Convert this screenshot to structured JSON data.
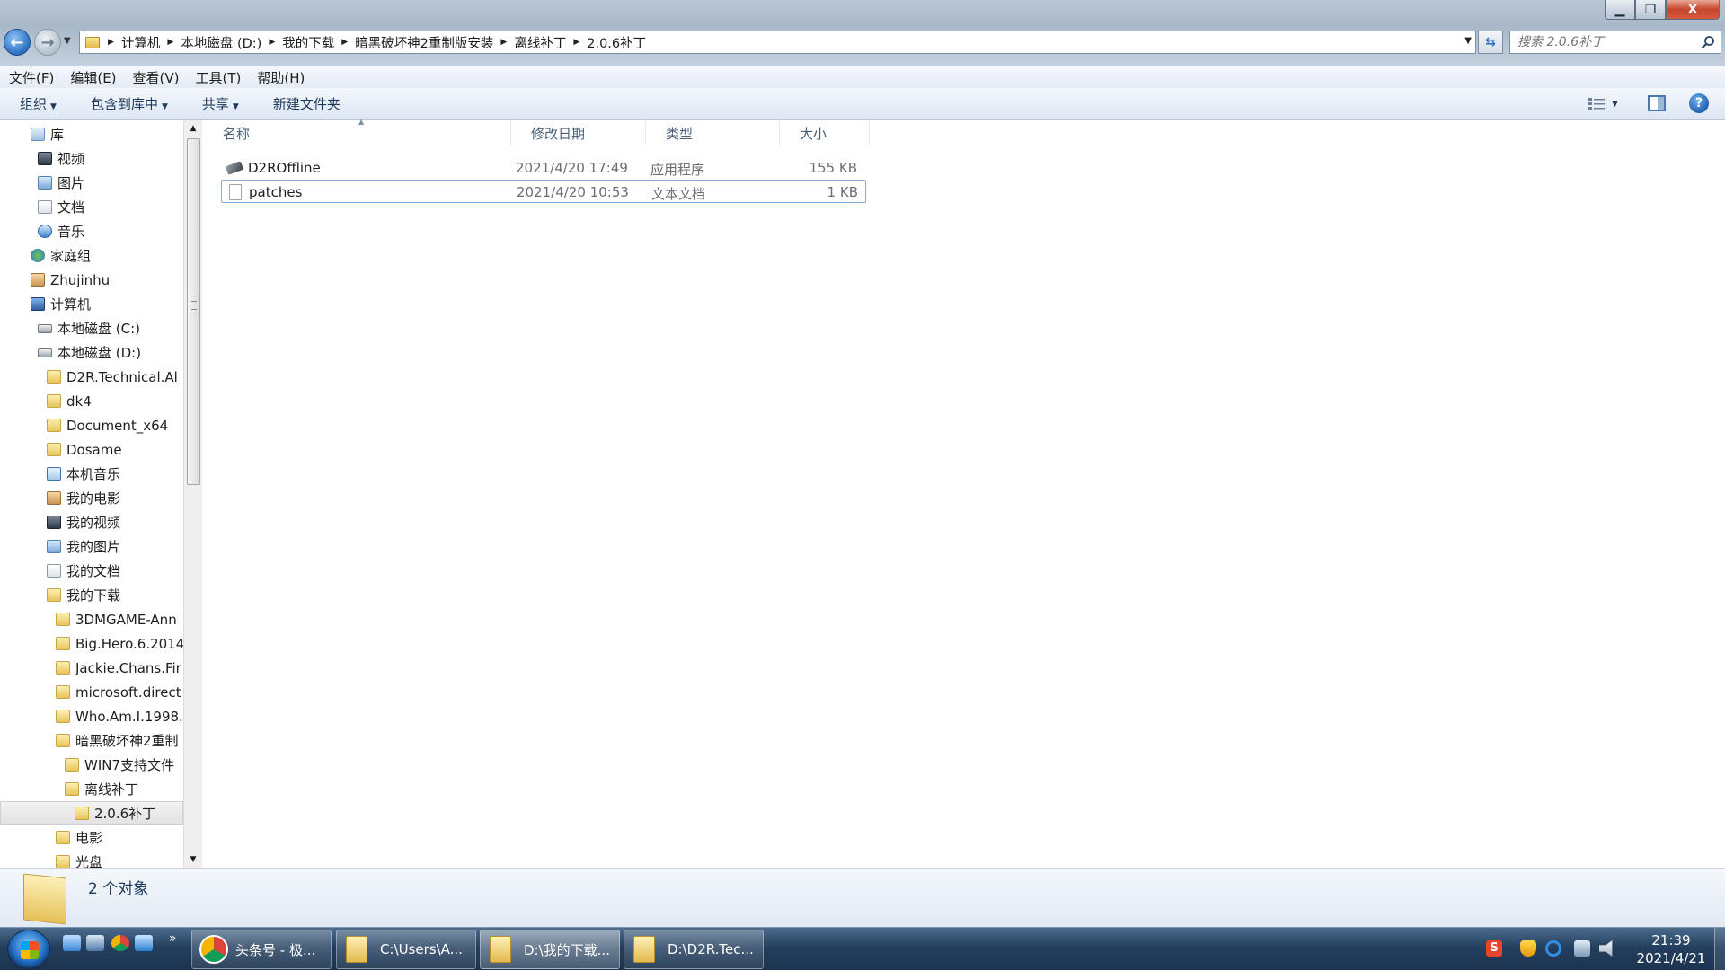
{
  "window": {
    "minimize_glyph": "▁",
    "maximize_glyph": "❐",
    "close_glyph": "X"
  },
  "address": {
    "crumbs": [
      "计算机",
      "本地磁盘 (D:)",
      "我的下载",
      "暗黑破坏神2重制版安装",
      "离线补丁",
      "2.0.6补丁"
    ],
    "search_placeholder": "搜索 2.0.6补丁"
  },
  "menu": {
    "items": [
      "文件(F)",
      "编辑(E)",
      "查看(V)",
      "工具(T)",
      "帮助(H)"
    ]
  },
  "commandbar": {
    "organize": "组织",
    "include_in_library": "包含到库中",
    "share": "共享",
    "new_folder": "新建文件夹",
    "help": "?"
  },
  "navpane": {
    "items": [
      {
        "label": "库",
        "icon": "library-icon"
      },
      {
        "label": "视频",
        "icon": "video-library-icon"
      },
      {
        "label": "图片",
        "icon": "picture-library-icon"
      },
      {
        "label": "文档",
        "icon": "document-library-icon"
      },
      {
        "label": "音乐",
        "icon": "music-library-icon"
      },
      {
        "label": "家庭组",
        "icon": "homegroup-icon"
      },
      {
        "label": "Zhujinhu",
        "icon": "user-folder-icon"
      },
      {
        "label": "计算机",
        "icon": "computer-icon"
      },
      {
        "label": "本地磁盘 (C:)",
        "icon": "drive-icon"
      },
      {
        "label": "本地磁盘 (D:)",
        "icon": "drive-icon"
      },
      {
        "label": "D2R.Technical.Al",
        "icon": "folder-icon"
      },
      {
        "label": "dk4",
        "icon": "folder-icon"
      },
      {
        "label": "Document_x64",
        "icon": "folder-icon"
      },
      {
        "label": "Dosame",
        "icon": "folder-icon"
      },
      {
        "label": "本机音乐",
        "icon": "download-folder-icon"
      },
      {
        "label": "我的电影",
        "icon": "movie-folder-icon"
      },
      {
        "label": "我的视频",
        "icon": "video-folder-icon"
      },
      {
        "label": "我的图片",
        "icon": "picture-folder-icon"
      },
      {
        "label": "我的文档",
        "icon": "document-folder-icon"
      },
      {
        "label": "我的下载",
        "icon": "folder-icon"
      },
      {
        "label": "3DMGAME-Ann",
        "icon": "folder-icon"
      },
      {
        "label": "Big.Hero.6.2014",
        "icon": "folder-icon"
      },
      {
        "label": "Jackie.Chans.Fir",
        "icon": "folder-icon"
      },
      {
        "label": "microsoft.direct",
        "icon": "folder-icon"
      },
      {
        "label": "Who.Am.I.1998.",
        "icon": "folder-icon"
      },
      {
        "label": "暗黑破坏神2重制",
        "icon": "folder-icon"
      },
      {
        "label": "WIN7支持文件",
        "icon": "folder-icon"
      },
      {
        "label": "离线补丁",
        "icon": "folder-icon"
      },
      {
        "label": "2.0.6补丁",
        "icon": "folder-icon"
      },
      {
        "label": "电影",
        "icon": "folder-icon"
      },
      {
        "label": "光盘",
        "icon": "folder-icon"
      }
    ],
    "selected_index": 28
  },
  "columns": {
    "name": "名称",
    "date": "修改日期",
    "type": "类型",
    "size": "大小"
  },
  "files": [
    {
      "name": "D2ROffline",
      "date": "2021/4/20 17:49",
      "type": "应用程序",
      "size": "155 KB",
      "icon": "executable-icon"
    },
    {
      "name": "patches",
      "date": "2021/4/20 10:53",
      "type": "文本文档",
      "size": "1 KB",
      "icon": "text-file-icon"
    }
  ],
  "details": {
    "count_text": "2 个对象"
  },
  "taskbar": {
    "tasks": [
      {
        "label": "头条号 - 极...",
        "icon": "chrome-icon"
      },
      {
        "label": "C:\\Users\\A...",
        "icon": "folder-icon"
      },
      {
        "label": "D:\\我的下载...",
        "icon": "folder-icon"
      },
      {
        "label": "D:\\D2R.Tec...",
        "icon": "folder-icon"
      }
    ],
    "active_index": 2,
    "more": "»",
    "tray_sogou": "S",
    "time": "21:39",
    "date": "2021/4/21"
  }
}
